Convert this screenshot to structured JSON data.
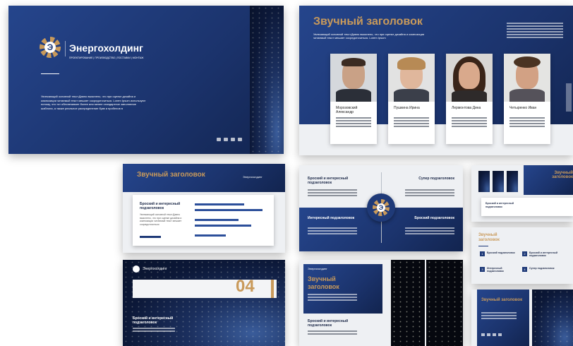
{
  "brand": {
    "name": "Энергохолдинг",
    "tagline": "ПРОЕКТИРОВАНИЕ | ПРОИЗВОДСТВО | ПОСТАВКИ | МОНТАЖ",
    "logo_letter": "Э"
  },
  "slide1": {
    "body": "Увлекающий основной текст.Давно выяснено, что при оценке дизайна и композиции читаемый текст мешает сосредоточиться. Lorem Ipsum используют потому, что тот обеспечивает более или менее стандартное заполнение шаблона, а также реальное распределение букв и пробелов в",
    "social": [
      "vk",
      "tw",
      "yt",
      "tg"
    ]
  },
  "slide2": {
    "title": "Звучный заголовок",
    "subtitle": "Увлекающий основной текст.Давно выяснено, что при оценке дизайна и композиции читаемый текст мешает сосредоточиться. Lorem Ipsum",
    "people": [
      {
        "name": "Морозовский Александр"
      },
      {
        "name": "Пушкина Ирина"
      },
      {
        "name": "Лермонтова Дина"
      },
      {
        "name": "Четыренко Иван"
      }
    ]
  },
  "slide3": {
    "title": "Звучный заголовок",
    "brand_small": "Энергохолдинг",
    "card_heading": "Броский и интересный подзаголовок",
    "card_body": "Увлекающий основной текст.Давно выяснено, что при оценке дизайна и композиции читаемый текст мешает сосредоточиться"
  },
  "slide4": {
    "q1": "Броский и интересный подзаголовок",
    "q2": "Супер подзаголовок",
    "q3": "Интересный подзаголовок",
    "q4": "Броский подзаголовок"
  },
  "slide5": {
    "title": "Звучный заголовок",
    "caption": "Броский и интересный подзаголовок"
  },
  "slide6": {
    "brand_small": "Энергохолдинг",
    "number": "04",
    "heading": "Броский и интересный подзаголовок"
  },
  "slide7": {
    "brand_small": "Энергохолдинг",
    "title": "Звучный заголовок",
    "heading": "Броский и интересный подзаголовок"
  },
  "slide8": {
    "title": "Звучный заголовок",
    "items": [
      {
        "num": "1",
        "label": "Броский подзаголовок"
      },
      {
        "num": "2",
        "label": "Броский и интересный подзаголовок"
      },
      {
        "num": "3",
        "label": "Интересный подзаголовок"
      },
      {
        "num": "4",
        "label": "Супер подзаголовок"
      }
    ]
  },
  "slide9": {
    "title": "Звучный заголовок"
  },
  "colors": {
    "navy": "#1f3a78",
    "gold": "#c99a5b",
    "light": "#eef0f3"
  }
}
